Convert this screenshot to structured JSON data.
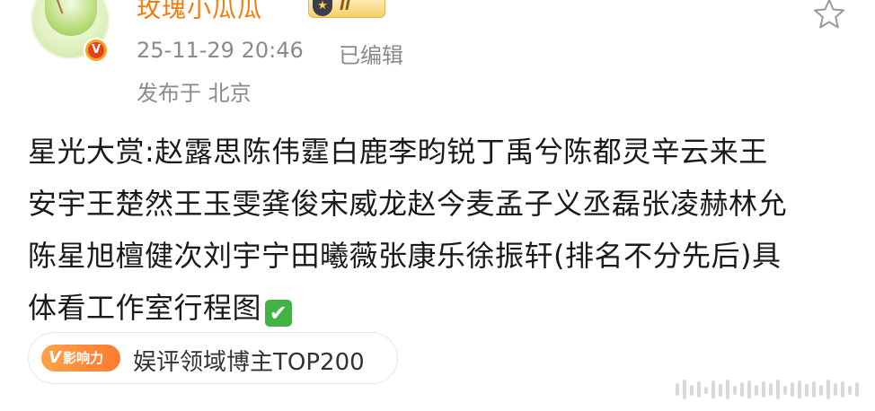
{
  "user": {
    "name": "玫瑰小瓜瓜",
    "level_badge": "II",
    "verified_mark": "V",
    "avatar_icon": "melon-avatar"
  },
  "meta": {
    "time": "25-11-29 20:46",
    "edited": "已编辑",
    "location": "发布于 北京"
  },
  "post": {
    "lines": [
      "星光大赏:赵露思陈伟霆白鹿李昀锐丁禹兮陈都灵辛云来王",
      "安宇王楚然王玉雯龚俊宋威龙赵今麦孟子义丞磊张凌赫林允",
      "陈星旭檀健次刘宇宁田曦薇张康乐徐振轩(排名不分先后)具",
      "体看工作室行程图"
    ],
    "emoji": "✔"
  },
  "influence": {
    "badge_v": "V",
    "badge_label": "影响力",
    "text": "娱评领域博主TOP200"
  },
  "colors": {
    "username": "#f57b07",
    "meta": "#8a8a8a",
    "content": "#1a1a1a",
    "badge_orange": "#ff7a2f",
    "check_green": "#43b244"
  },
  "icons": {
    "favorite": "star-outline-icon",
    "watermark": "weibo-watermark"
  }
}
